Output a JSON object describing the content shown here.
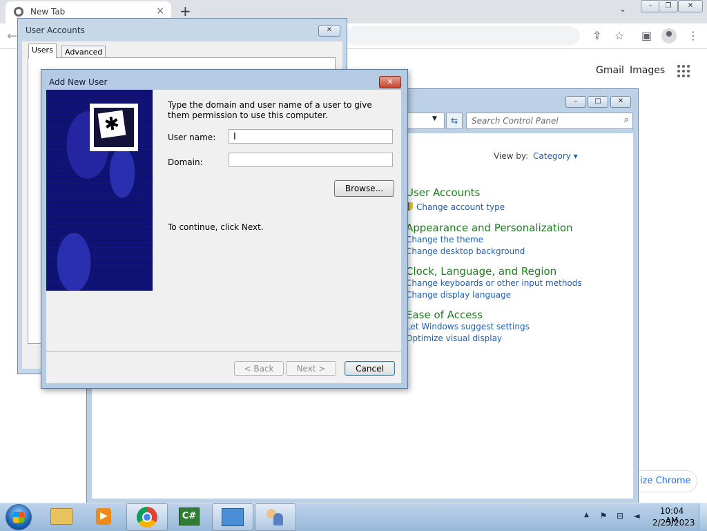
{
  "browser": {
    "tab_title": "New Tab",
    "tab_close": "×",
    "new_tab": "+",
    "tab_search": "⌄",
    "win_min": "–",
    "win_max": "❐",
    "win_close": "✕",
    "header_links": {
      "gmail": "Gmail",
      "images": "Images"
    },
    "customize_label": "ize Chrome"
  },
  "user_accounts": {
    "title": "User Accounts",
    "close": "✕",
    "tabs": [
      {
        "label": "Users"
      },
      {
        "label": "Advanced"
      }
    ]
  },
  "add_user": {
    "title": "Add New User",
    "close": "✕",
    "instructions": "Type the domain and user name of a user to give them permission to use this computer.",
    "username_label": "User name:",
    "username_value": "",
    "domain_label": "Domain:",
    "domain_value": "",
    "browse": "Browse...",
    "continue_text": "To continue, click Next.",
    "back": "< Back",
    "next": "Next >",
    "cancel": "Cancel",
    "key_glyph": "✱"
  },
  "control_panel": {
    "search_placeholder": "Search Control Panel",
    "view_by_label": "View by:",
    "view_by_value": "Category ▾",
    "win_min": "–",
    "win_max": "□",
    "win_close": "✕",
    "categories": [
      {
        "heading": "User Accounts",
        "links": [
          "Change account type"
        ]
      },
      {
        "heading": "Appearance and Personalization",
        "links": [
          "Change the theme",
          "Change desktop background"
        ]
      },
      {
        "heading": "Clock, Language, and Region",
        "links": [
          "Change keyboards or other input methods",
          "Change display language"
        ]
      },
      {
        "heading": "Ease of Access",
        "links": [
          "Let Windows suggest settings",
          "Optimize visual display"
        ]
      }
    ]
  },
  "taskbar": {
    "csharp_label": "C#",
    "clock_time": "10:04 AM",
    "clock_date": "2/25/2023"
  }
}
